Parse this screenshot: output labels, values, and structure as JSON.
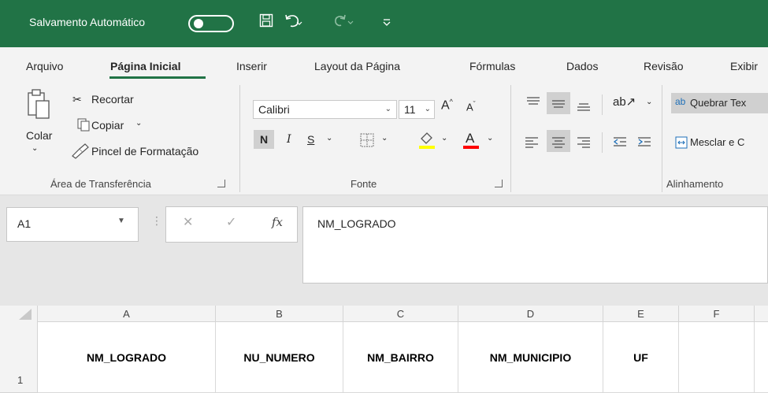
{
  "titlebar": {
    "autosave_label": "Salvamento Automático",
    "autosave_toggle_state": "off",
    "qat_icons": [
      "save-icon",
      "undo-icon",
      "redo-icon",
      "customize-qat-icon"
    ],
    "color": "#217346"
  },
  "tabs": [
    {
      "label": "Arquivo"
    },
    {
      "label": "Página Inicial",
      "active": true
    },
    {
      "label": "Inserir"
    },
    {
      "label": "Layout da Página"
    },
    {
      "label": "Fórmulas"
    },
    {
      "label": "Dados"
    },
    {
      "label": "Revisão"
    },
    {
      "label": "Exibir"
    }
  ],
  "ribbon": {
    "clipboard": {
      "paste_label": "Colar",
      "cut_label": "Recortar",
      "copy_label": "Copiar",
      "format_painter_label": "Pincel de Formatação",
      "group_label": "Área de Transferência"
    },
    "font": {
      "font_name": "Calibri",
      "font_size": "11",
      "bold_label": "N",
      "italic_label": "I",
      "underline_label": "S",
      "group_label": "Fonte",
      "highlight_color": "#ffff00",
      "font_color": "#ff0000"
    },
    "alignment": {
      "wrap_text_label": "Quebrar Tex",
      "merge_label": "Mesclar e C",
      "group_label": "Alinhamento"
    }
  },
  "formula_bar": {
    "name_box": "A1",
    "fx_label": "fx",
    "formula": "NM_LOGRADO"
  },
  "grid": {
    "columns": [
      "A",
      "B",
      "C",
      "D",
      "E",
      "F"
    ],
    "rows": [
      {
        "number": "1",
        "cells": [
          "NM_LOGRADO",
          "NU_NUMERO",
          "NM_BAIRRO",
          "NM_MUNICIPIO",
          "UF",
          ""
        ]
      }
    ]
  }
}
